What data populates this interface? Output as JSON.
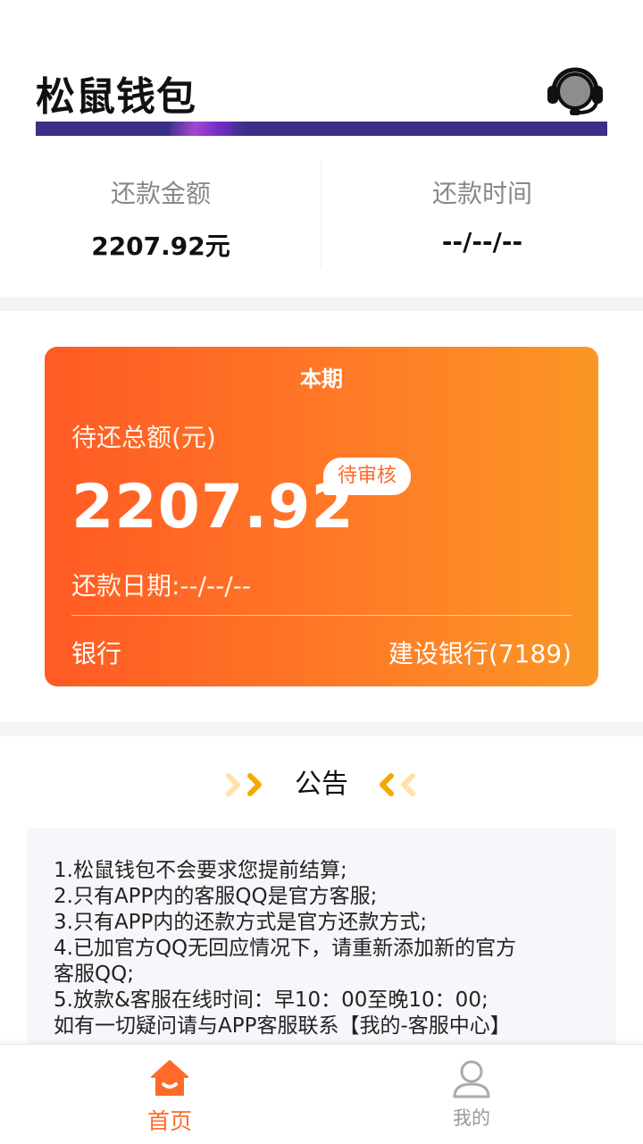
{
  "header": {
    "title": "松鼠钱包",
    "support_icon": "headset-icon"
  },
  "summary": {
    "amount_label": "还款金额",
    "amount_value": "2207.92元",
    "time_label": "还款时间",
    "time_value": "--/--/--"
  },
  "card": {
    "period": "本期",
    "pending_label": "待还总额(元)",
    "amount": "2207.92",
    "status": "待审核",
    "due_date": "还款日期:--/--/--",
    "bank_label": "银行",
    "bank_value": "建设银行(7189)"
  },
  "notice": {
    "title": "公告",
    "lines": [
      "1.松鼠钱包不会要求您提前结算;",
      "2.只有APP内的客服QQ是官方客服;",
      "3.只有APP内的还款方式是官方还款方式;",
      "4.已加官方QQ无回应情况下，请重新添加新的官方",
      "客服QQ;",
      "5.放款&客服在线时间：早10：00至晚10：00;",
      "如有一切疑问请与APP客服联系【我的-客服中心】"
    ]
  },
  "nav": {
    "home_label": "首页",
    "mine_label": "我的",
    "active": "home"
  },
  "colors": {
    "accent": "#ff6a2a",
    "card_start": "#ff5a24",
    "card_end": "#fb9726",
    "banner": "#3b2f86"
  }
}
